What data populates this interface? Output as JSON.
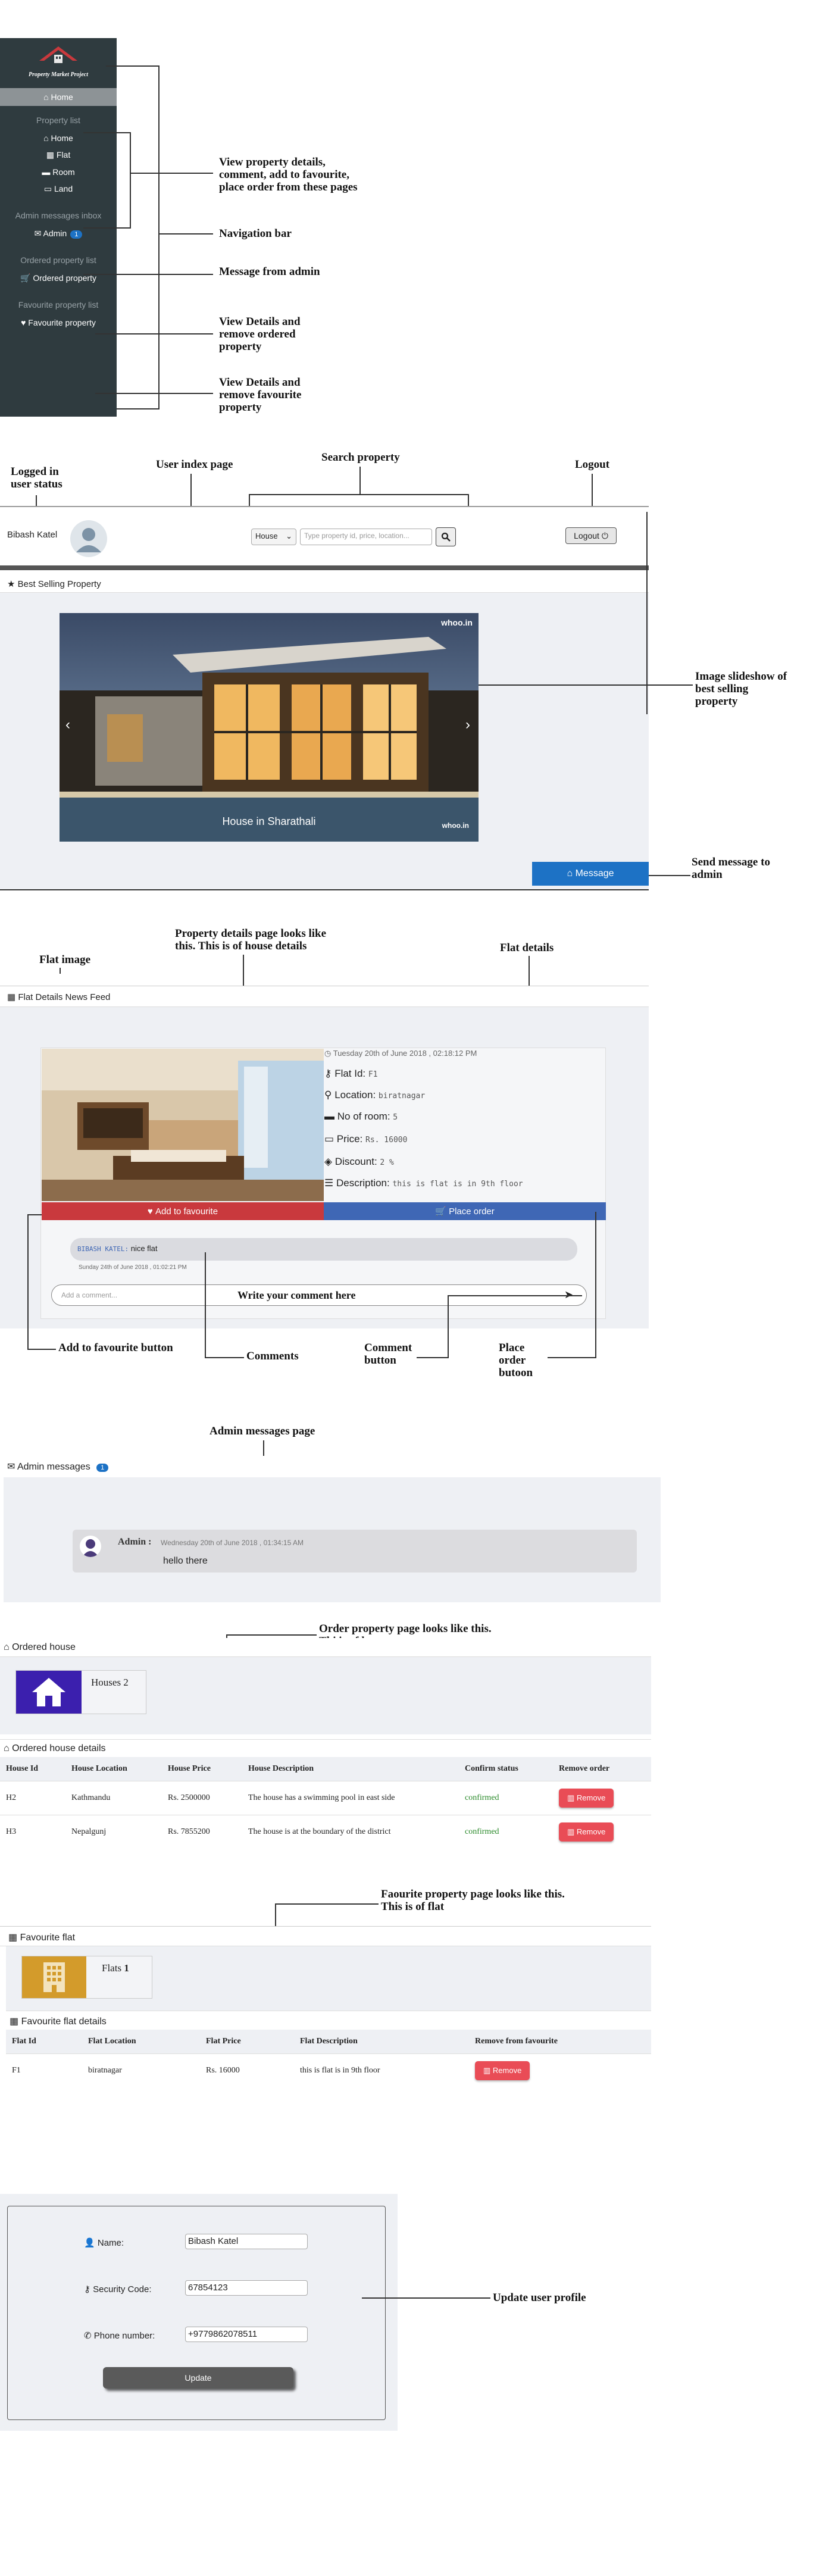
{
  "sidebar": {
    "brand": "Property Market Project",
    "home": "Home",
    "property_list": "Property list",
    "items": [
      "Home",
      "Flat",
      "Room",
      "Land"
    ],
    "admin_inbox": "Admin messages inbox",
    "admin": "Admin",
    "admin_badge": "1",
    "ordered_list": "Ordered property list",
    "ordered": "Ordered property",
    "favourite_list": "Favourite property list",
    "favourite": "Favourite property"
  },
  "annotations": {
    "view_details": "View property details, comment, add to favourite, place order from these pages",
    "nav_bar": "Navigation bar",
    "msg_admin": "Message from admin",
    "view_ordered": "View Details and remove ordered property",
    "view_fav": "View Details and remove favourite property",
    "logged_in": "Logged in user status",
    "user_index": "User index page",
    "search_property": "Search property",
    "logout": "Logout",
    "slideshow": "Image slideshow of best selling property",
    "send_msg": "Send message to admin",
    "flat_image": "Flat image",
    "details_page": "Property details page looks like this. This is of house details",
    "flat_details": "Flat details",
    "add_fav": "Add to favourite button",
    "comments": "Comments",
    "comment_button": "Comment button",
    "place_order": "Place order butoon",
    "admin_page": "Admin messages page",
    "order_page": "Order property page looks like this. Thi is of house",
    "fav_page": "Faourite property page looks like this. This is of flat",
    "update_profile": "Update user profile",
    "write_comment": "Write your comment here"
  },
  "header": {
    "username": "Bibash Katel",
    "select_value": "House",
    "search_placeholder": "Type property id, price, location...",
    "logout": "Logout"
  },
  "best_selling": {
    "title": "Best Selling Property",
    "watermark": "whoo.in",
    "caption": "House in Sharathali",
    "logo": "whoo.in",
    "message_btn": "Message"
  },
  "flat_details": {
    "title": "Flat Details News Feed",
    "date": "Tuesday 20th of June 2018 , 02:18:12 PM",
    "flat_id_label": "Flat Id:",
    "flat_id": "F1",
    "location_label": "Location:",
    "location": "biratnagar",
    "rooms_label": "No of room:",
    "rooms": "5",
    "price_label": "Price:",
    "price": "Rs. 16000",
    "discount_label": "Discount:",
    "discount": "2 %",
    "description_label": "Description:",
    "description": "this is flat is in 9th floor",
    "add_fav": "Add to favourite",
    "place_order": "Place order",
    "comment_user": "BIBASH KATEL:",
    "comment_text": "nice flat",
    "comment_date": "Sunday 24th of June 2018 , 01:02:21 PM",
    "comment_placeholder": "Add a comment..."
  },
  "admin_messages": {
    "title": "Admin messages",
    "badge": "1",
    "sender": "Admin :",
    "date": "Wednesday 20th of June 2018 , 01:34:15 AM",
    "text": "hello there"
  },
  "ordered": {
    "title": "Ordered house",
    "card": "Houses 2",
    "details_title": "Ordered house details",
    "columns": [
      "House Id",
      "House Location",
      "House Price",
      "House Description",
      "Confirm status",
      "Remove order"
    ],
    "rows": [
      [
        "H2",
        "Kathmandu",
        "Rs. 2500000",
        "The house has a swimming pool in east side",
        "confirmed",
        "Remove"
      ],
      [
        "H3",
        "Nepalgunj",
        "Rs. 7855200",
        "The house is at the boundary of the district",
        "confirmed",
        "Remove"
      ]
    ]
  },
  "favourite": {
    "title": "Favourite flat",
    "card_label": "Flats",
    "card_count": "1",
    "details_title": "Favourite flat details",
    "columns": [
      "Flat Id",
      "Flat Location",
      "Flat Price",
      "Flat Description",
      "Remove from favourite"
    ],
    "rows": [
      [
        "F1",
        "biratnagar",
        "Rs. 16000",
        "this is flat is in 9th floor",
        "Remove"
      ]
    ]
  },
  "profile": {
    "name_label": "Name:",
    "name": "Bibash Katel",
    "code_label": "Security Code:",
    "code": "67854123",
    "phone_label": "Phone number:",
    "phone": "+9779862078511",
    "update": "Update"
  },
  "colors": {
    "sidebar": "#2f3b3f",
    "blue": "#1d72c5",
    "red": "#c9393d",
    "place_order": "#3f67b5",
    "house_icon": "#3b1fae",
    "flat_icon": "#d39b2b"
  }
}
